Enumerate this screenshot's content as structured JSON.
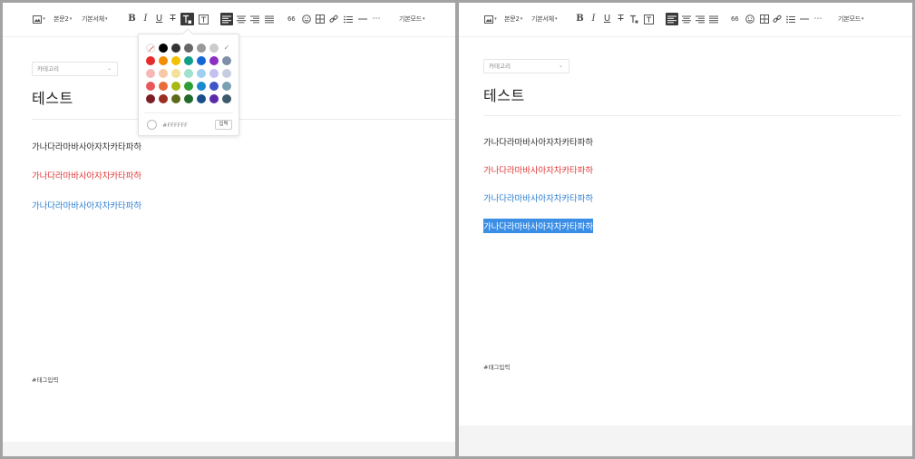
{
  "toolbar": {
    "paragraph_style": "본문2",
    "font_style": "기본서체",
    "quote_label": "66",
    "mode": "기본모드"
  },
  "icons": [
    "image-icon",
    "bold-icon",
    "italic-icon",
    "underline-icon",
    "strikethrough-icon",
    "text-color-icon",
    "text-background-icon",
    "align-left-icon",
    "align-center-icon",
    "align-right-icon",
    "align-justify-icon",
    "quote-icon",
    "emoji-icon",
    "table-icon",
    "link-icon",
    "list-icon",
    "horizontal-rule-icon",
    "more-icon"
  ],
  "left": {
    "category": "카테고리",
    "title": "테스트",
    "paragraphs": [
      "가나다라마바사아자차카타파하",
      "가나다라마바사아자차카타파하",
      "가나다라마바사아자차카타파하"
    ],
    "tag_placeholder": "#태그입력"
  },
  "right": {
    "category": "카테고리",
    "title": "테스트",
    "paragraphs": [
      "가나다라마바사아자차카타파하",
      "가나다라마바사아자차카타파하",
      "가나다라마바사아자차카타파하",
      "가나다라마바사아자차카타파하"
    ],
    "tag_placeholder": "#태그입력"
  },
  "color_picker": {
    "hex_value": "#FFFFFF",
    "apply_label": "입력",
    "colors": [
      [
        "none",
        "#000000",
        "#333333",
        "#666666",
        "#999999",
        "#cccccc",
        "check"
      ],
      [
        "#e52b2b",
        "#f28c00",
        "#f2c200",
        "#0f9e8a",
        "#1466d6",
        "#8b2fc2",
        "#7f8fa6"
      ],
      [
        "#f7b7b7",
        "#f7c9a8",
        "#f1e19a",
        "#9fe0cf",
        "#9fd0f2",
        "#c4c0f0",
        "#c7cde0"
      ],
      [
        "#e8585a",
        "#e96a3a",
        "#a8b814",
        "#2e9e36",
        "#1a8ad0",
        "#3e55c8",
        "#7aa0b0"
      ],
      [
        "#7a1d24",
        "#9b2d21",
        "#5c6a1a",
        "#1f6b2a",
        "#1a4e8a",
        "#5a2aa8",
        "#3e5a6a"
      ]
    ]
  },
  "colors": {
    "red_text": "#e03a3a",
    "blue_text": "#2f7fd1",
    "selection": "#3a8ee6",
    "active_button": "#3a3a3a"
  }
}
